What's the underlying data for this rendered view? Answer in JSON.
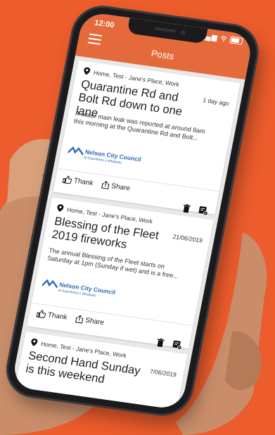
{
  "status": {
    "time": "12:00",
    "signal": "▂▄▆",
    "wifi": "wifi-icon"
  },
  "header": {
    "title": "Posts",
    "menu_icon": "hamburger-menu-icon"
  },
  "colors": {
    "background": "#ec5c2c",
    "header": "#e46a3b",
    "link": "#2f6ab3"
  },
  "posts": [
    {
      "location": "Home, Test - Jane's Place, Work",
      "date": "1 day ago",
      "title": "Quarantine Rd and Bolt Rd down to one lane",
      "summary": "A water main leak was reported at around 8am this morning at the Quarantine Rd and Bolt...",
      "org_name": "Nelson City Council",
      "org_sub": "te Kaunihera o Whakatū",
      "thank_label": "Thank",
      "share_label": "Share"
    },
    {
      "location": "Home, Test - Jane's Place, Work",
      "date": "21/06/2019",
      "title": "Blessing of the Fleet 2019 fireworks",
      "summary": "The annual Blessing of the Fleet starts on Saturday at 1pm (Sunday if wet) and is a free...",
      "org_name": "Nelson City Council",
      "org_sub": "te Kaunihera o Whakatū",
      "thank_label": "Thank",
      "share_label": "Share"
    },
    {
      "location": "Home, Test - Jane's Place, Work",
      "date": "7/06/2019",
      "title": "Second Hand Sunday is this weekend"
    }
  ]
}
